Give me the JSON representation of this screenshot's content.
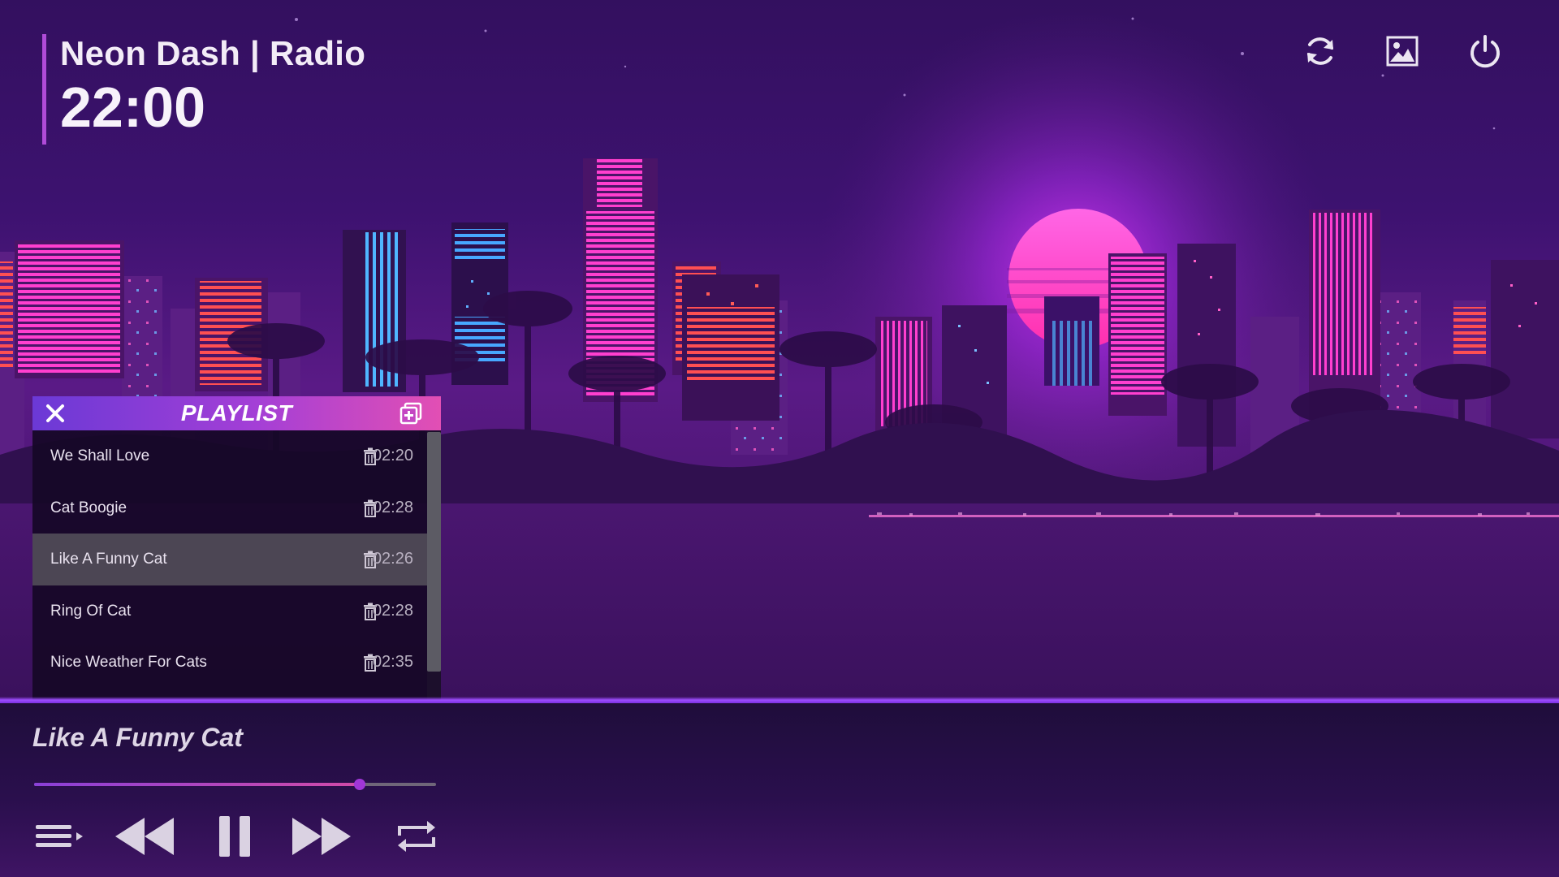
{
  "header": {
    "station_title": "Neon Dash | Radio",
    "clock": "22:00"
  },
  "top_actions": [
    {
      "name": "refresh-icon"
    },
    {
      "name": "image-icon"
    },
    {
      "name": "power-icon"
    }
  ],
  "playlist": {
    "title": "PLAYLIST",
    "close_icon": "close-icon",
    "add_icon": "add-playlist-icon",
    "tracks": [
      {
        "name": "We Shall Love",
        "duration": "02:20",
        "active": false
      },
      {
        "name": "Cat Boogie",
        "duration": "02:28",
        "active": false
      },
      {
        "name": "Like A Funny Cat",
        "duration": "02:26",
        "active": true
      },
      {
        "name": "Ring Of Cat",
        "duration": "02:28",
        "active": false
      },
      {
        "name": "Nice Weather For Cats",
        "duration": "02:35",
        "active": false
      }
    ]
  },
  "player": {
    "now_playing": "Like A Funny Cat",
    "progress_fraction": 0.81,
    "controls": [
      "playlist-toggle-icon",
      "rewind-icon",
      "pause-icon",
      "fast-forward-icon",
      "repeat-icon"
    ]
  },
  "colors": {
    "accent": "#a136d8",
    "sky_top": "#33105f",
    "sun": "#ff3fd0",
    "neon_pink": "#ff2fb4",
    "neon_red": "#ff4a5a",
    "neon_blue": "#3ca8ff"
  }
}
